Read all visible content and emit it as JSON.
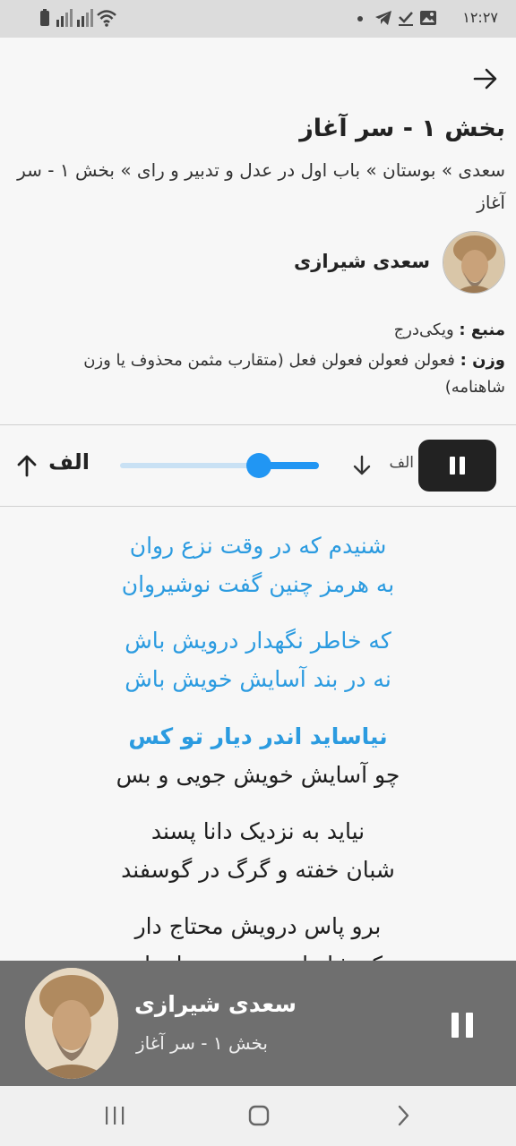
{
  "status_bar": {
    "time": "۱۲:۲۷",
    "icons": [
      "battery-icon",
      "signal-icon",
      "signal-icon-2",
      "wifi-icon",
      "dot-icon",
      "telegram-icon",
      "check-icon",
      "image-icon"
    ]
  },
  "header": {
    "back_icon": "arrow-right-icon",
    "title": "بخش ۱ - سر آغاز",
    "breadcrumb": "سعدی » بوستان » باب اول در عدل و تدبیر و رای » بخش ۱ - سر آغاز"
  },
  "poet": {
    "name": "سعدی شیرازی"
  },
  "meta": {
    "source_label": "منبع :",
    "source_value": "ویکی‌درج",
    "meter_label": "وزن :",
    "meter_value": "فعولن فعولن فعولن فعل (متقارب مثمن محذوف یا وزن شاهنامه)"
  },
  "controls": {
    "pause_icon": "pause-icon",
    "font_decrease_label": "الف",
    "font_increase_label": "الف",
    "font_size_level": 0.3,
    "accent_color": "#2196f3"
  },
  "poem": {
    "couplets": [
      {
        "line1": "شنیدم که در وقت نزع روان",
        "line2": "به هرمز چنین گفت نوشیروان"
      },
      {
        "line1": "که خاطر نگهدار درویش باش",
        "line2": "نه در بند آسایش خویش باش"
      },
      {
        "line1": "نیاساید اندر دیار تو کس",
        "line2": "چو آسایش خویش جویی و بس"
      },
      {
        "line1": "نیاید به نزدیک دانا پسند",
        "line2": "شبان خفته و گرگ در گوسفند"
      },
      {
        "line1": "برو پاس درویش محتاج دار",
        "line2": "که شاه از رعیت بود تاجدار"
      }
    ],
    "highlight_color": "#2b9be0"
  },
  "mini_player": {
    "title": "سعدی شیرازی",
    "subtitle": "بخش ۱ - سر آغاز",
    "pause_icon": "pause-icon",
    "background": "#6f6f6f"
  },
  "navbar": {
    "icons": [
      "recent-apps-icon",
      "home-icon",
      "back-icon"
    ]
  }
}
